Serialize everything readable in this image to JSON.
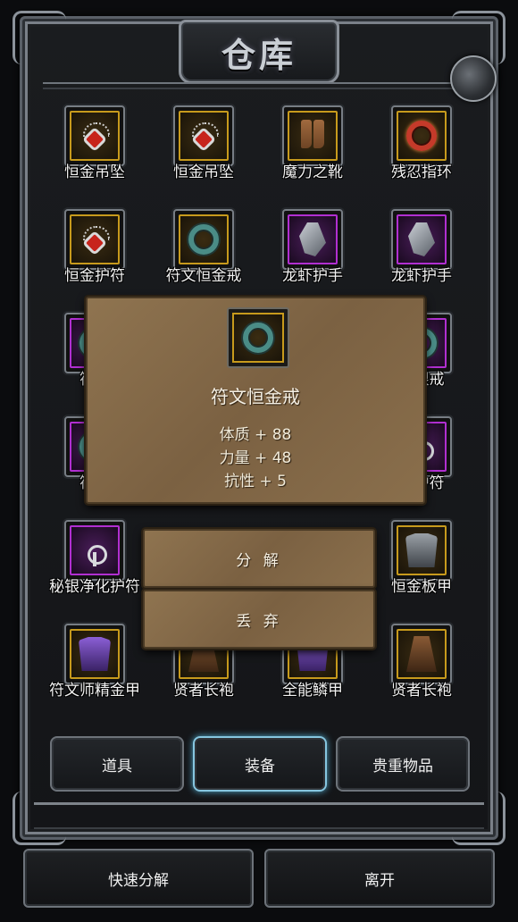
{
  "window": {
    "title": "仓库"
  },
  "items": [
    {
      "name": "恒金吊坠",
      "rarity": "gold",
      "icon": "pendant-icon"
    },
    {
      "name": "恒金吊坠",
      "rarity": "gold",
      "icon": "pendant-icon"
    },
    {
      "name": "魔力之靴",
      "rarity": "gold",
      "icon": "boots-icon"
    },
    {
      "name": "残忍指环",
      "rarity": "gold",
      "icon": "red-ring-icon"
    },
    {
      "name": "恒金护符",
      "rarity": "gold",
      "icon": "pendant-icon"
    },
    {
      "name": "符文恒金戒",
      "rarity": "gold",
      "icon": "ring-icon"
    },
    {
      "name": "龙虾护手",
      "rarity": "epic",
      "icon": "gauntlet-icon"
    },
    {
      "name": "龙虾护手",
      "rarity": "epic",
      "icon": "gauntlet-icon"
    },
    {
      "name": "符文",
      "rarity": "epic",
      "icon": "ring-icon"
    },
    {
      "name": "",
      "rarity": "",
      "icon": ""
    },
    {
      "name": "",
      "rarity": "",
      "icon": ""
    },
    {
      "name": "秘银戒",
      "rarity": "epic",
      "icon": "ring-icon"
    },
    {
      "name": "符文",
      "rarity": "epic",
      "icon": "ring-icon"
    },
    {
      "name": "",
      "rarity": "",
      "icon": ""
    },
    {
      "name": "",
      "rarity": "",
      "icon": ""
    },
    {
      "name": "化护符",
      "rarity": "epic",
      "icon": "amulet-icon"
    },
    {
      "name": "秘银净化护符",
      "rarity": "epic",
      "icon": "amulet-icon"
    },
    {
      "name": "",
      "rarity": "",
      "icon": ""
    },
    {
      "name": "",
      "rarity": "",
      "icon": ""
    },
    {
      "name": "恒金板甲",
      "rarity": "gold",
      "icon": "plate-armor-icon"
    },
    {
      "name": "符文师精金甲",
      "rarity": "gold",
      "icon": "purple-armor-icon"
    },
    {
      "name": "贤者长袍",
      "rarity": "gold",
      "icon": "robe-icon"
    },
    {
      "name": "全能鳞甲",
      "rarity": "gold",
      "icon": "purple-armor-icon"
    },
    {
      "name": "贤者长袍",
      "rarity": "gold",
      "icon": "robe-icon"
    }
  ],
  "tooltip": {
    "item_name": "符文恒金戒",
    "icon": "ring-icon",
    "stats": [
      "体质 + 88",
      "力量 + 48",
      "抗性 + 5"
    ]
  },
  "actions": {
    "decompose": "分 解",
    "discard": "丢 弃"
  },
  "tabs": [
    {
      "label": "道具",
      "active": false
    },
    {
      "label": "装备",
      "active": true
    },
    {
      "label": "贵重物品",
      "active": false
    }
  ],
  "bottom": {
    "quick_decompose": "快速分解",
    "leave": "离开"
  },
  "colors": {
    "gold_border": "#c79a1c",
    "epic_border": "#b12fd1",
    "active_tab_glow": "#86c6e0",
    "parchment": "#7b6142"
  }
}
